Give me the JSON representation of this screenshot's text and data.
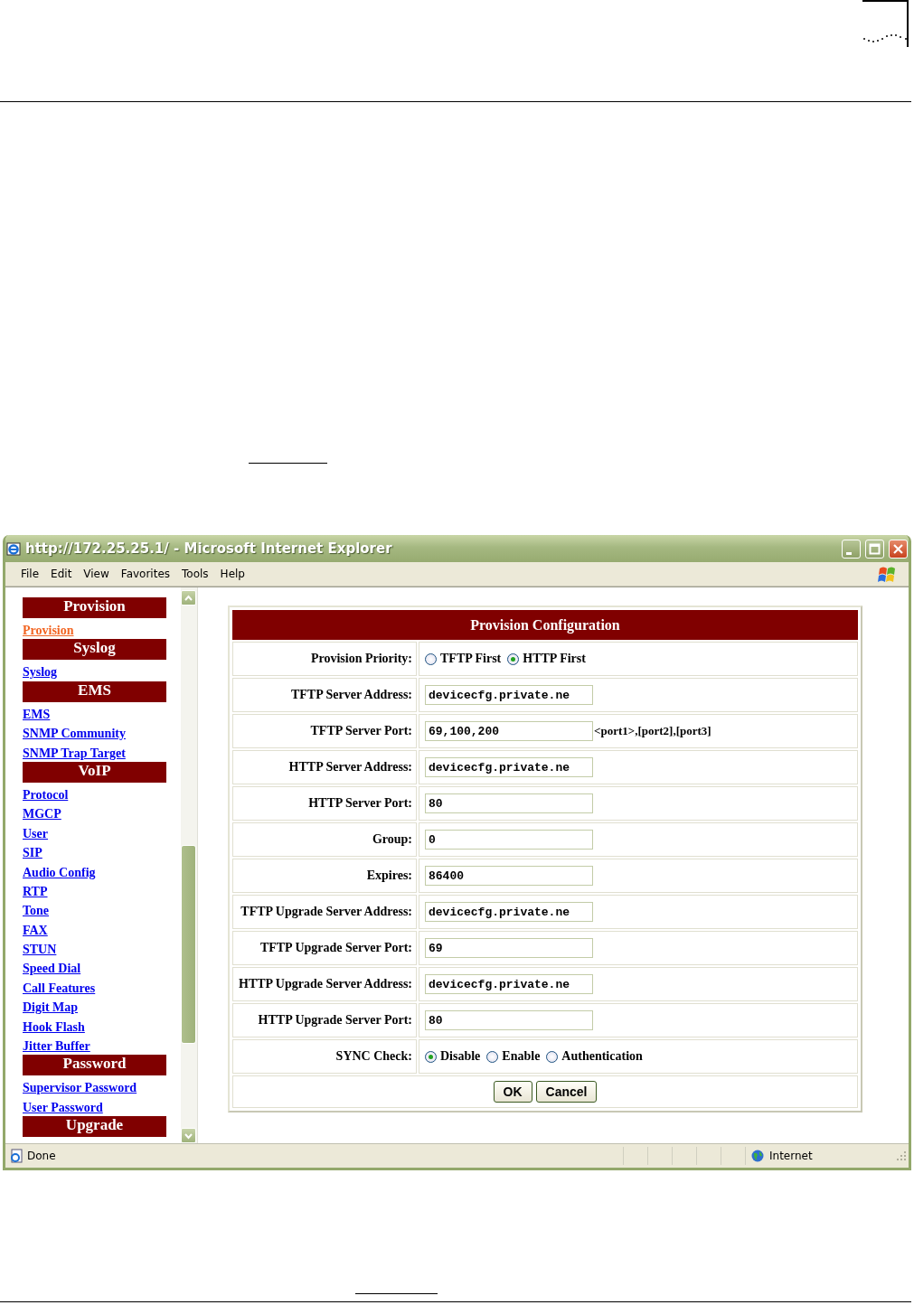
{
  "window": {
    "title": "http://172.25.25.1/ - Microsoft Internet Explorer"
  },
  "menu": [
    "File",
    "Edit",
    "View",
    "Favorites",
    "Tools",
    "Help"
  ],
  "sidebar": {
    "items": [
      {
        "kind": "header",
        "label": "Provision"
      },
      {
        "kind": "link",
        "label": "Provision",
        "selected": true
      },
      {
        "kind": "header",
        "label": "Syslog"
      },
      {
        "kind": "link",
        "label": "Syslog",
        "selected": false
      },
      {
        "kind": "header",
        "label": "EMS"
      },
      {
        "kind": "link",
        "label": "EMS",
        "selected": false
      },
      {
        "kind": "link",
        "label": "SNMP Community",
        "selected": false
      },
      {
        "kind": "link",
        "label": "SNMP Trap Target",
        "selected": false
      },
      {
        "kind": "header",
        "label": "VoIP"
      },
      {
        "kind": "link",
        "label": "Protocol",
        "selected": false
      },
      {
        "kind": "link",
        "label": "MGCP",
        "selected": false
      },
      {
        "kind": "link",
        "label": "User",
        "selected": false
      },
      {
        "kind": "link",
        "label": "SIP",
        "selected": false
      },
      {
        "kind": "link",
        "label": "Audio Config",
        "selected": false
      },
      {
        "kind": "link",
        "label": "RTP",
        "selected": false
      },
      {
        "kind": "link",
        "label": "Tone",
        "selected": false
      },
      {
        "kind": "link",
        "label": "FAX",
        "selected": false
      },
      {
        "kind": "link",
        "label": "STUN",
        "selected": false
      },
      {
        "kind": "link",
        "label": "Speed Dial",
        "selected": false
      },
      {
        "kind": "link",
        "label": "Call Features",
        "selected": false
      },
      {
        "kind": "link",
        "label": "Digit Map",
        "selected": false
      },
      {
        "kind": "link",
        "label": "Hook Flash",
        "selected": false
      },
      {
        "kind": "link",
        "label": "Jitter Buffer",
        "selected": false
      },
      {
        "kind": "header",
        "label": "Password"
      },
      {
        "kind": "link",
        "label": "Supervisor Password",
        "selected": false
      },
      {
        "kind": "link",
        "label": "User Password",
        "selected": false
      },
      {
        "kind": "header",
        "label": "Upgrade"
      }
    ]
  },
  "form": {
    "title": "Provision Configuration",
    "rows": [
      {
        "kind": "radio",
        "label": "Provision Priority:",
        "options": [
          {
            "label": "TFTP First",
            "selected": false
          },
          {
            "label": "HTTP First",
            "selected": true
          }
        ]
      },
      {
        "kind": "input",
        "label": "TFTP Server Address:",
        "value": "devicecfg.private.ne"
      },
      {
        "kind": "input",
        "label": "TFTP Server Port:",
        "value": "69,100,200",
        "hint": "<port1>,[port2],[port3]"
      },
      {
        "kind": "input",
        "label": "HTTP Server Address:",
        "value": "devicecfg.private.ne"
      },
      {
        "kind": "input",
        "label": "HTTP Server Port:",
        "value": "80"
      },
      {
        "kind": "input",
        "label": "Group:",
        "value": "0"
      },
      {
        "kind": "input",
        "label": "Expires:",
        "value": "86400"
      },
      {
        "kind": "input",
        "label": "TFTP Upgrade Server Address:",
        "value": "devicecfg.private.ne"
      },
      {
        "kind": "input",
        "label": "TFTP Upgrade Server Port:",
        "value": "69"
      },
      {
        "kind": "input",
        "label": "HTTP Upgrade Server Address:",
        "value": "devicecfg.private.ne"
      },
      {
        "kind": "input",
        "label": "HTTP Upgrade Server Port:",
        "value": "80"
      },
      {
        "kind": "radio",
        "label": "SYNC Check:",
        "options": [
          {
            "label": "Disable",
            "selected": true
          },
          {
            "label": "Enable",
            "selected": false
          },
          {
            "label": "Authentication",
            "selected": false
          }
        ]
      }
    ],
    "buttons": [
      "OK",
      "Cancel"
    ]
  },
  "status_bar": {
    "text": "Done",
    "zone": "Internet"
  }
}
